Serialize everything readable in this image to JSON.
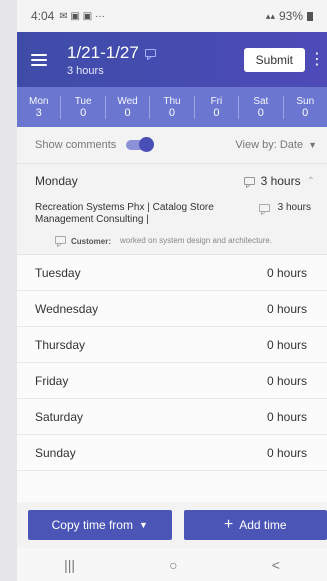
{
  "status_bar": {
    "time": "4:04",
    "icons_left": "✉ ▣ ▣ ···",
    "battery": "93%"
  },
  "header": {
    "title": "1/21-1/27",
    "subtitle": "3 hours",
    "submit_label": "Submit",
    "accent": "#4e4bb8"
  },
  "days": [
    {
      "name": "Mon",
      "value": "3"
    },
    {
      "name": "Tue",
      "value": "0"
    },
    {
      "name": "Wed",
      "value": "0"
    },
    {
      "name": "Thu",
      "value": "0"
    },
    {
      "name": "Fri",
      "value": "0"
    },
    {
      "name": "Sat",
      "value": "0"
    },
    {
      "name": "Sun",
      "value": "0"
    }
  ],
  "options": {
    "show_comments_label": "Show comments",
    "show_comments_on": true,
    "view_by_label": "View by: Date"
  },
  "monday": {
    "label": "Monday",
    "hours": "3 hours",
    "entry": {
      "project": "Recreation Systems Phx | Catalog Store Management Consulting |",
      "hours": "3 hours"
    },
    "comment": {
      "label": "Customer:",
      "text": "worked on system design and architecture."
    }
  },
  "other_days": [
    {
      "label": "Tuesday",
      "hours": "0 hours"
    },
    {
      "label": "Wednesday",
      "hours": "0 hours"
    },
    {
      "label": "Thursday",
      "hours": "0 hours"
    },
    {
      "label": "Friday",
      "hours": "0 hours"
    },
    {
      "label": "Saturday",
      "hours": "0 hours"
    },
    {
      "label": "Sunday",
      "hours": "0 hours"
    }
  ],
  "actions": {
    "copy_label": "Copy time from",
    "add_label": "Add time"
  },
  "nav": {
    "recents": "|||",
    "home": "○",
    "back": "<"
  }
}
